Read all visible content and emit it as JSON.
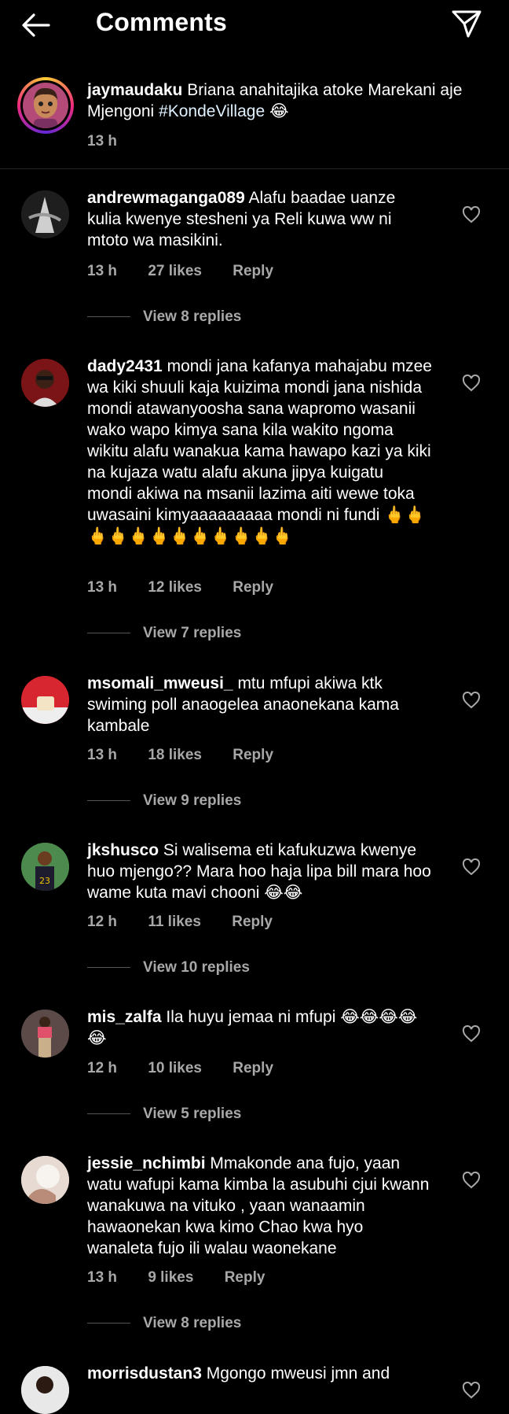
{
  "header": {
    "title": "Comments"
  },
  "caption": {
    "username": "jaymaudaku",
    "text": "Briana anahitajika atoke Marekani aje Mjengoni ",
    "hashtag": "#KondeVillage",
    "emoji": " 😂",
    "time": "13 h"
  },
  "comments": [
    {
      "username": "andrewmaganga089",
      "text": "Alafu baadae uanze kulia kwenye stesheni ya Reli kuwa ww ni mtoto wa masikini.",
      "time": "13 h",
      "likes": "27 likes",
      "reply": "Reply",
      "view_replies": "View 8 replies"
    },
    {
      "username": "dady2431",
      "text": "mondi jana kafanya mahajabu mzee wa kiki shuuli kaja kuizima mondi jana nishida mondi atawanyoosha sana wapromo wasanii wako wapo kimya sana kila wakito ngoma wikitu alafu wanakua kama hawapo kazi ya kiki na kujaza watu alafu akuna jipya kuigatu mondi akiwa na msanii lazima aiti wewe toka uwasaini kimyaaaaaaaaa mondi ni fundi 🖕🖕🖕🖕🖕🖕🖕🖕🖕🖕🖕🖕",
      "time": "13 h",
      "likes": "12 likes",
      "reply": "Reply",
      "view_replies": "View 7 replies"
    },
    {
      "username": "msomali_mweusi_",
      "text": "mtu mfupi akiwa ktk swiming poll anaogelea anaonekana kama kambale",
      "time": "13 h",
      "likes": "18 likes",
      "reply": "Reply",
      "view_replies": "View 9 replies"
    },
    {
      "username": "jkshusco",
      "text": "Si walisema eti kafukuzwa kwenye huo mjengo?? Mara hoo haja lipa bill mara hoo wame kuta mavi chooni 😂😂",
      "time": "12 h",
      "likes": "11 likes",
      "reply": "Reply",
      "view_replies": "View 10 replies"
    },
    {
      "username": "mis_zalfa",
      "text": "Ila huyu jemaa ni mfupi 😂😂😂😂😂",
      "time": "12 h",
      "likes": "10 likes",
      "reply": "Reply",
      "view_replies": "View 5 replies"
    },
    {
      "username": "jessie_nchimbi",
      "text": "Mmakonde ana fujo, yaan watu wafupi kama kimba la asubuhi cjui kwann wanakuwa na vituko , yaan wanaamin hawaonekan kwa kimo Chao kwa hyo wanaleta fujo ili walau waonekane",
      "time": "13 h",
      "likes": "9 likes",
      "reply": "Reply",
      "view_replies": "View 8 replies"
    },
    {
      "username": "morrisdustan3",
      "text": "Mgongo mweusi jmn and"
    }
  ],
  "icons": {
    "back": "arrow-left-icon",
    "send": "paper-plane-icon",
    "like": "heart-outline-icon"
  }
}
